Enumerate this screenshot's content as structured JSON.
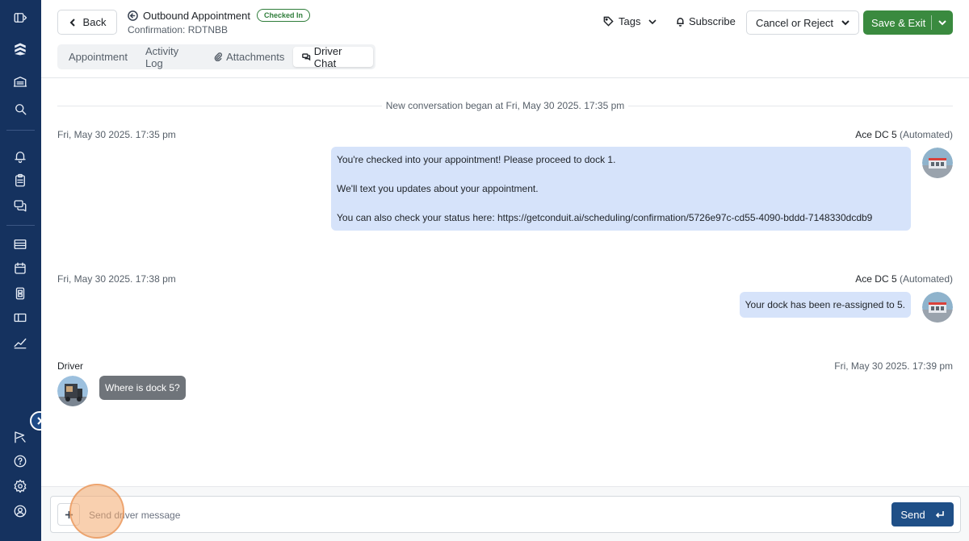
{
  "sidebar": {
    "icons": [
      "panel-toggle-icon",
      "logo-icon",
      "warehouse-icon",
      "search-icon",
      "bell-icon",
      "clipboard-icon",
      "chat-icon",
      "dock-list-icon",
      "calendar-icon",
      "yard-icon",
      "ticket-icon",
      "chart-icon",
      "flag-icon",
      "help-icon",
      "settings-icon",
      "user-icon"
    ]
  },
  "header": {
    "back_label": "Back",
    "title": "Outbound Appointment",
    "status_badge": "Checked In",
    "confirmation": "Confirmation: RDTNBB",
    "tags_label": "Tags",
    "subscribe_label": "Subscribe",
    "cancel_label": "Cancel or Reject",
    "save_label": "Save & Exit",
    "tabs": [
      {
        "label": "Appointment",
        "active": false
      },
      {
        "label": "Activity Log",
        "active": false
      },
      {
        "label": "Attachments",
        "active": false
      },
      {
        "label": "Driver Chat",
        "active": true
      }
    ]
  },
  "chat": {
    "conversation_start": "New conversation began at Fri, May 30 2025. 17:35 pm",
    "messages": [
      {
        "direction": "outgoing",
        "timestamp": "Fri, May 30 2025. 17:35 pm",
        "sender": "Ace DC 5",
        "sender_tag": "(Automated)",
        "lines": [
          "You're checked into your appointment! Please proceed to dock 1.",
          "We'll text you updates about your appointment.",
          "You can also check your status here: https://getconduit.ai/scheduling/confirmation/5726e97c-cd55-4090-bddd-7148330dcdb9"
        ]
      },
      {
        "direction": "outgoing",
        "timestamp": "Fri, May 30 2025. 17:38 pm",
        "sender": "Ace DC 5",
        "sender_tag": "(Automated)",
        "lines": [
          "Your dock has been re-assigned to 5."
        ]
      },
      {
        "direction": "incoming",
        "timestamp": "Fri, May 30 2025. 17:39 pm",
        "sender": "Driver",
        "lines": [
          "Where is dock 5?"
        ]
      }
    ]
  },
  "composer": {
    "placeholder": "Send driver message",
    "value": "",
    "send_label": "Send"
  },
  "colors": {
    "sidebar": "#15325f",
    "primary": "#1f4f87",
    "success": "#3a8a3f",
    "outgoing_bubble": "#d6e3fa",
    "incoming_bubble": "#6f747a"
  }
}
